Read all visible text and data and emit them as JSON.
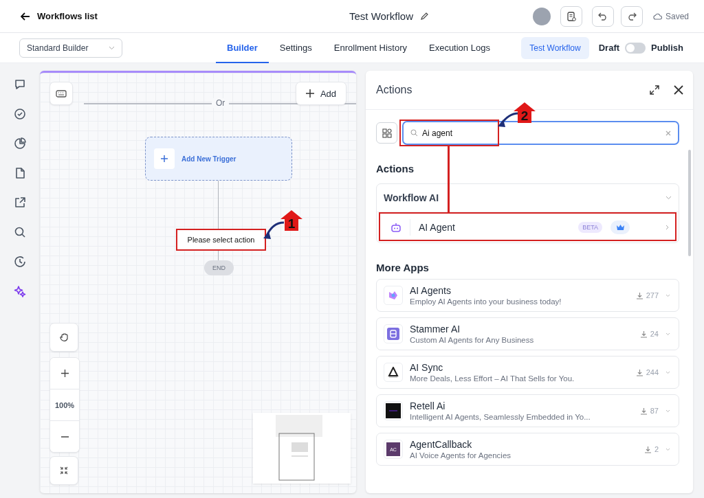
{
  "header": {
    "back_label": "Workflows list",
    "title": "Test Workflow",
    "status": "Saved"
  },
  "toolbar": {
    "builder_select": "Standard Builder",
    "tabs": [
      {
        "label": "Builder",
        "selected": true
      },
      {
        "label": "Settings",
        "selected": false
      },
      {
        "label": "Enrollment History",
        "selected": false
      },
      {
        "label": "Execution Logs",
        "selected": false
      }
    ],
    "test_button": "Test Workflow",
    "draft_label": "Draft",
    "publish_label": "Publish",
    "published": false
  },
  "sidebar": {
    "items": [
      {
        "kind": "chat",
        "selected": false
      },
      {
        "kind": "check",
        "selected": false
      },
      {
        "kind": "pie",
        "selected": false
      },
      {
        "kind": "file",
        "selected": false
      },
      {
        "kind": "share",
        "selected": false
      },
      {
        "kind": "search",
        "selected": false
      },
      {
        "kind": "history",
        "selected": false
      },
      {
        "kind": "sparkle",
        "selected": true
      }
    ]
  },
  "canvas": {
    "or_label": "Or",
    "add_button": "Add",
    "trigger": "Add New Trigger",
    "action_node": "Please select action",
    "end_label": "END",
    "zoom": "100%"
  },
  "actions_panel": {
    "title": "Actions",
    "search": {
      "value": "Ai agent"
    },
    "section_title": "Actions",
    "group": {
      "title": "Workflow AI",
      "expanded": true,
      "items": [
        {
          "label": "AI Agent",
          "badge": "BETA"
        }
      ]
    },
    "more_apps_title": "More Apps",
    "apps": [
      {
        "kind": "agents",
        "name": "AI Agents",
        "description": "Employ AI Agents into your business today!",
        "installs": "277"
      },
      {
        "kind": "stammer",
        "name": "Stammer AI",
        "description": "Custom AI Agents for Any Business",
        "installs": "24"
      },
      {
        "kind": "sync",
        "name": "AI Sync",
        "description": "More Deals, Less Effort – AI That Sells for You.",
        "installs": "244"
      },
      {
        "kind": "retell",
        "name": "Retell Ai",
        "description": "Intelligent AI Agents, Seamlessly Embedded in Yo...",
        "installs": "87"
      },
      {
        "kind": "callback",
        "logo_text": "AC",
        "name": "AgentCallback",
        "description": "AI Voice Agents for Agencies",
        "installs": "2"
      }
    ]
  },
  "annotations": [
    {
      "number": "1"
    },
    {
      "number": "2"
    }
  ]
}
